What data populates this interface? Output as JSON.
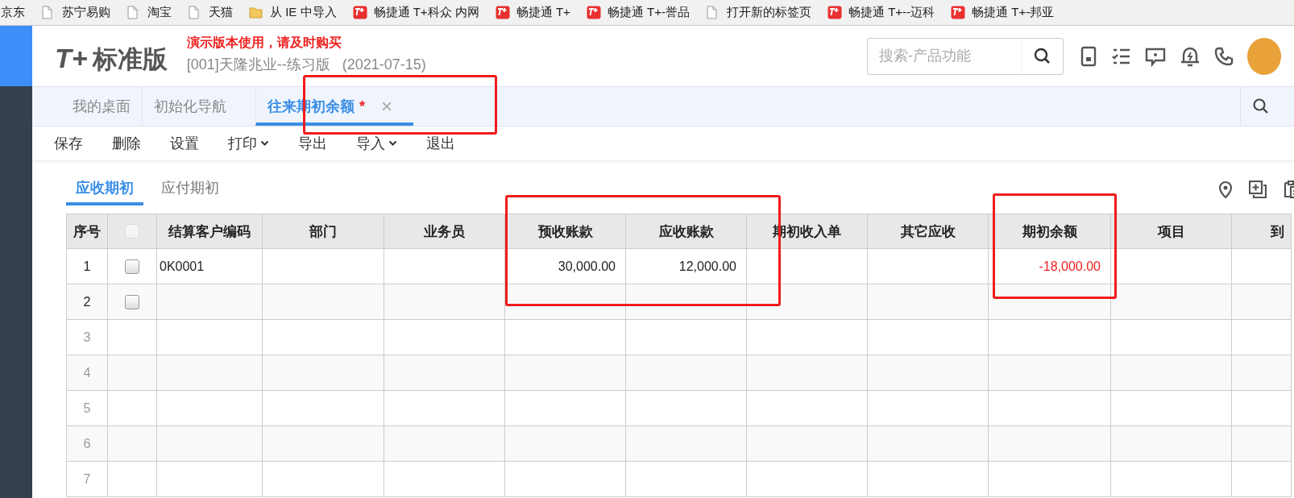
{
  "bookmarks": [
    {
      "label": "京东",
      "kind": "none"
    },
    {
      "label": "苏宁易购",
      "kind": "page"
    },
    {
      "label": "淘宝",
      "kind": "page"
    },
    {
      "label": "天猫",
      "kind": "page"
    },
    {
      "label": "从 IE 中导入",
      "kind": "folder"
    },
    {
      "label": "畅捷通 T+科众  内网",
      "kind": "app"
    },
    {
      "label": "畅捷通 T+",
      "kind": "app"
    },
    {
      "label": "畅捷通 T+-誉品",
      "kind": "app"
    },
    {
      "label": "打开新的标签页",
      "kind": "page"
    },
    {
      "label": "畅捷通 T+--迈科",
      "kind": "app"
    },
    {
      "label": "畅捷通 T+-邦亚",
      "kind": "app"
    }
  ],
  "header": {
    "logo_mark": "T+",
    "logo_text": "标准版",
    "notice": "演示版本使用，请及时购买",
    "account": "[001]天隆兆业--练习版   (2021-07-15)",
    "search": {
      "placeholder": "搜索-产品功能"
    }
  },
  "tabs": [
    {
      "label": "我的桌面",
      "selected": false,
      "modified": false
    },
    {
      "label": "初始化导航",
      "selected": false,
      "modified": false
    },
    {
      "label": "往来期初余额",
      "selected": true,
      "modified": true,
      "mark": "*",
      "close": "×"
    }
  ],
  "toolbar": [
    {
      "label": "保存",
      "dropdown": false
    },
    {
      "label": "删除",
      "dropdown": false
    },
    {
      "label": "设置",
      "dropdown": false
    },
    {
      "label": "打印",
      "dropdown": true
    },
    {
      "label": "导出",
      "dropdown": false
    },
    {
      "label": "导入",
      "dropdown": true
    },
    {
      "label": "退出",
      "dropdown": false
    }
  ],
  "sub_tabs": [
    {
      "label": "应收期初",
      "selected": true
    },
    {
      "label": "应付期初",
      "selected": false
    }
  ],
  "table": {
    "select_all": {
      "checked": false,
      "disabled": true
    },
    "columns": [
      "序号",
      "结算客户编码",
      "部门",
      "业务员",
      "预收账款",
      "应收账款",
      "期初收入单",
      "其它应收",
      "期初余额",
      "项目",
      "到"
    ],
    "rows": [
      {
        "kind": "data",
        "number": "1",
        "checked": false,
        "customer_code": "0K0001",
        "advance_received": "30,000.00",
        "receivable": "12,000.00",
        "opening_balance": "-18,000.00",
        "balance_negative": true
      },
      {
        "kind": "data",
        "number": "2",
        "checked": false
      },
      {
        "kind": "blank",
        "number": "3"
      },
      {
        "kind": "blank",
        "number": "4"
      },
      {
        "kind": "blank",
        "number": "5"
      },
      {
        "kind": "blank",
        "number": "6"
      },
      {
        "kind": "blank",
        "number": "7"
      }
    ]
  }
}
